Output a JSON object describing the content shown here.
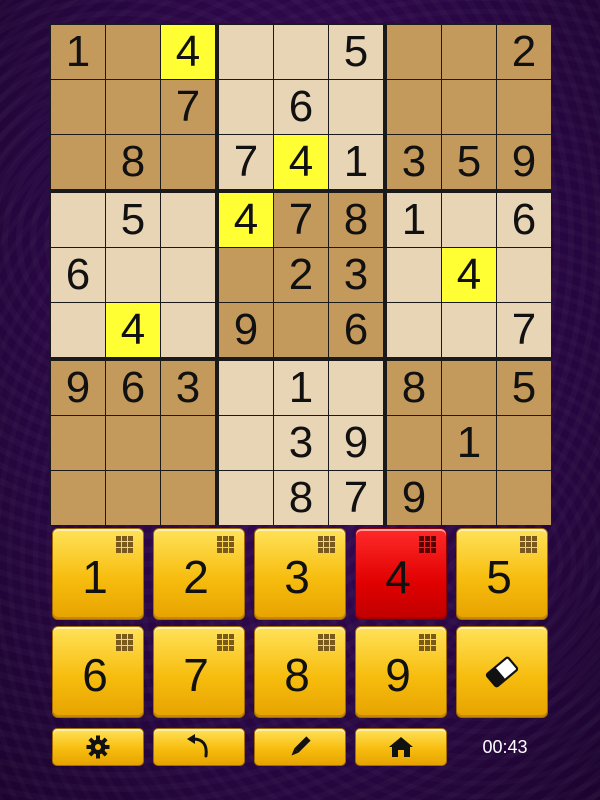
{
  "board": {
    "grid": [
      [
        "1",
        "",
        "4",
        "",
        "",
        "5",
        "",
        "",
        "2"
      ],
      [
        "",
        "",
        "7",
        "",
        "6",
        "",
        "",
        "",
        ""
      ],
      [
        "",
        "8",
        "",
        "7",
        "4",
        "1",
        "3",
        "5",
        "9"
      ],
      [
        "",
        "5",
        "",
        "4",
        "7",
        "8",
        "1",
        "",
        "6"
      ],
      [
        "6",
        "",
        "",
        "",
        "2",
        "3",
        "",
        "4",
        ""
      ],
      [
        "",
        "4",
        "",
        "9",
        "",
        "6",
        "",
        "",
        "7"
      ],
      [
        "9",
        "6",
        "3",
        "",
        "1",
        "",
        "8",
        "",
        "5"
      ],
      [
        "",
        "",
        "",
        "",
        "3",
        "9",
        "",
        "1",
        ""
      ],
      [
        "",
        "",
        "",
        "",
        "8",
        "7",
        "9",
        "",
        ""
      ]
    ],
    "highlighted": [
      [
        0,
        2
      ],
      [
        2,
        4
      ],
      [
        3,
        3
      ],
      [
        4,
        7
      ],
      [
        5,
        1
      ]
    ],
    "colors": {
      "light": "#e8d5b5",
      "dark": "#c49a5c",
      "highlight": "#ffff33"
    }
  },
  "numpad": {
    "keys": [
      "1",
      "2",
      "3",
      "4",
      "5",
      "6",
      "7",
      "8",
      "9"
    ],
    "selected": "4",
    "eraser_icon": "eraser-icon"
  },
  "toolbar": {
    "icons": [
      "gear-icon",
      "undo-icon",
      "pencil-icon",
      "home-icon"
    ],
    "timer": "00:43"
  }
}
